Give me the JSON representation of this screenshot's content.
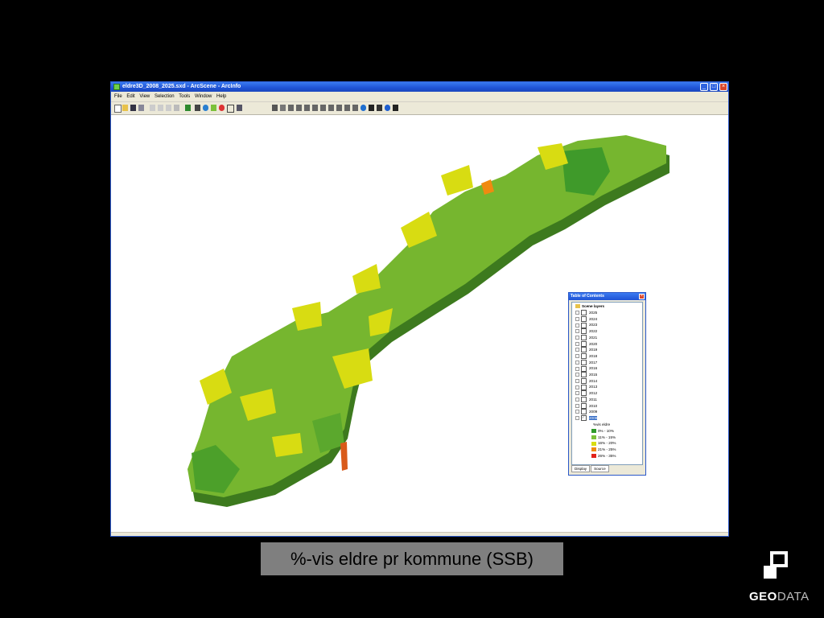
{
  "window": {
    "title": "eldre3D_2008_2025.sxd - ArcScene - ArcInfo",
    "menu": [
      "File",
      "Edit",
      "View",
      "Selection",
      "Tools",
      "Window",
      "Help"
    ],
    "controls": {
      "minimize": "_",
      "maximize": "□",
      "close": "×"
    }
  },
  "toc": {
    "title": "Table of Contents",
    "close": "×",
    "root": "Scene layers",
    "years": [
      "2025",
      "2024",
      "2023",
      "2022",
      "2021",
      "2020",
      "2019",
      "2018",
      "2017",
      "2016",
      "2015",
      "2014",
      "2013",
      "2012",
      "2011",
      "2010",
      "2009",
      "2008"
    ],
    "selected_year": "2008",
    "legend_title": "%vis eldre",
    "legend": [
      {
        "label": "0% - 10%",
        "color": "#2f9a2c"
      },
      {
        "label": "11% - 15%",
        "color": "#7bc13a"
      },
      {
        "label": "16% - 20%",
        "color": "#d8dc12"
      },
      {
        "label": "21% - 25%",
        "color": "#f08a10"
      },
      {
        "label": "26% - 35%",
        "color": "#e2231a"
      }
    ],
    "tabs": [
      "Display",
      "Source"
    ]
  },
  "caption": "%-vis eldre pr kommune (SSB)",
  "logo": {
    "bold": "GEO",
    "rest": "DATA"
  }
}
